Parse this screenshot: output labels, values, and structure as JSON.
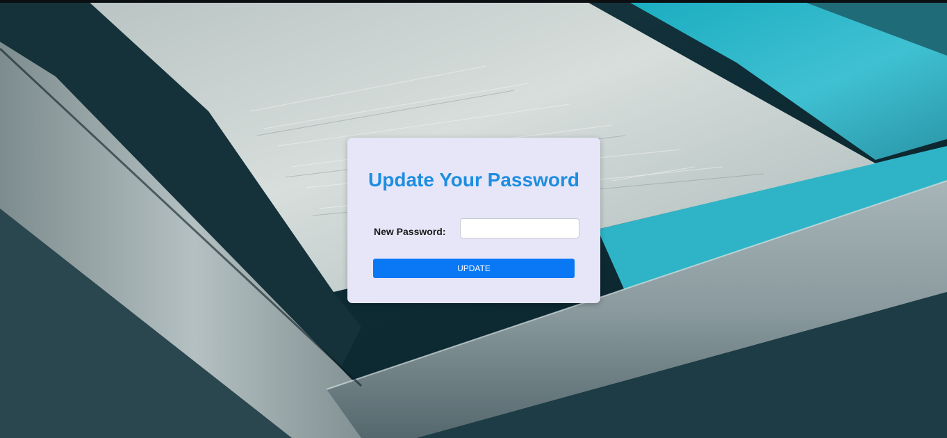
{
  "form": {
    "title": "Update Your Password",
    "password_label": "New Password:",
    "password_value": "",
    "submit_label": "UPDATE"
  },
  "colors": {
    "title": "#1f8de0",
    "button": "#0a78f4",
    "card": "#e6e6f8"
  }
}
